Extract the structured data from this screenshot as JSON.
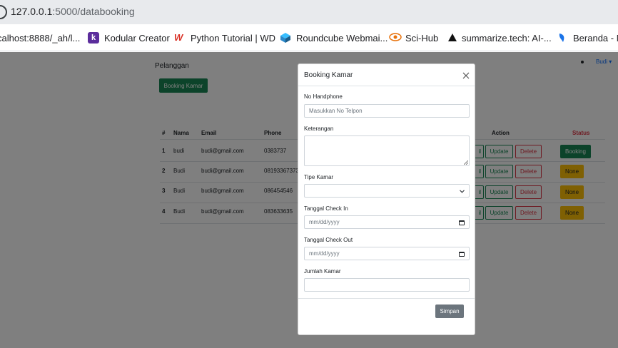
{
  "browser": {
    "url_host": "127.0.0.1",
    "url_rest": ":5000/databooking",
    "bookmarks": [
      {
        "label": "calhost:8888/_ah/l...",
        "icon": "globe-icon"
      },
      {
        "label": "Kodular Creator",
        "icon": "kodular-icon"
      },
      {
        "label": "Python Tutorial | WD",
        "icon": "w3-icon"
      },
      {
        "label": "Roundcube Webmai...",
        "icon": "roundcube-icon"
      },
      {
        "label": "Sci-Hub",
        "icon": "scihub-icon"
      },
      {
        "label": "summarize.tech: AI-...",
        "icon": "triangle-icon"
      },
      {
        "label": "Beranda - M",
        "icon": "leaf-icon"
      }
    ]
  },
  "navbar": {
    "brand": "Pelanggan",
    "user": "Budi ▾"
  },
  "main": {
    "booking_button": "Booking Kamar",
    "table": {
      "headers": [
        "#",
        "Nama",
        "Email",
        "Phone",
        "Action",
        "Status"
      ],
      "rows": [
        {
          "no": "1",
          "nama": "budi",
          "email": "budi@gmail.com",
          "phone": "0383737",
          "status": "Booking",
          "status_color": "green"
        },
        {
          "no": "2",
          "nama": "Budi",
          "email": "budi@gmail.com",
          "phone": "08193367373",
          "status": "None",
          "status_color": "yellow"
        },
        {
          "no": "3",
          "nama": "Budi",
          "email": "budi@gmail.com",
          "phone": "086454546",
          "status": "None",
          "status_color": "yellow"
        },
        {
          "no": "4",
          "nama": "Budi",
          "email": "budi@gmail.com",
          "phone": "083633635",
          "status": "None",
          "status_color": "yellow"
        }
      ],
      "action_labels": {
        "edit_tail": "il",
        "update": "Update",
        "delete": "Delete"
      }
    }
  },
  "modal": {
    "title": "Booking Kamar",
    "fields": {
      "phone_label": "No Handphone",
      "phone_placeholder": "Masukkan No Telpon",
      "phone_value": "",
      "notes_label": "Keterangan",
      "notes_value": "",
      "room_type_label": "Tipe Kamar",
      "room_type_value": "",
      "checkin_label": "Tanggal Check In",
      "checkin_value": "mm/dd/yyyy",
      "checkout_label": "Tanggal Check Out",
      "checkout_value": "mm/dd/yyyy",
      "rooms_label": "Jumlah Kamar",
      "rooms_value": ""
    },
    "submit_button": "Simpan"
  },
  "colors": {
    "success": "#198754",
    "danger": "#dc3545",
    "warning": "#ffc107",
    "secondary": "#6c757d",
    "primary": "#0d6efd",
    "status_header": "#dc3545"
  }
}
